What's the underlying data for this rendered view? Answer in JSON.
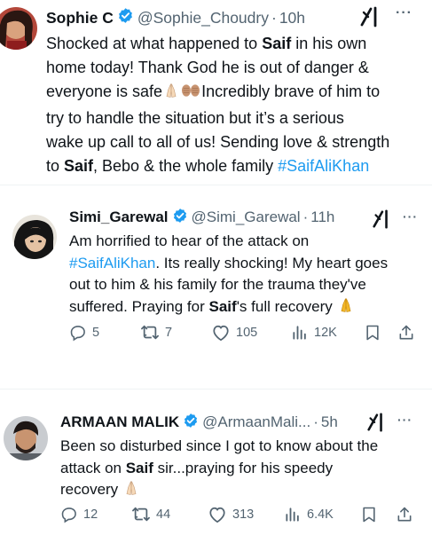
{
  "tweets": [
    {
      "name": "Sophie C",
      "handle": "@Sophie_Choudry",
      "time": "10h",
      "lines": [
        [
          {
            "t": "Shocked at what happened to "
          },
          {
            "t": "Saif",
            "s": "b"
          },
          {
            "t": " in his own"
          }
        ],
        [
          {
            "t": "home today! Thank God he is out of danger &"
          }
        ],
        [
          {
            "t": "everyone is safe"
          },
          {
            "e": "pray"
          },
          {
            "e": "hug"
          },
          {
            "t": "Incredibly brave of him to"
          }
        ],
        [
          {
            "t": "try to handle the situation but it’s a serious"
          }
        ],
        [
          {
            "t": "wake up call to all of us! Sending love & strength"
          }
        ],
        [
          {
            "t": "to "
          },
          {
            "t": "Saif",
            "s": "b"
          },
          {
            "t": ", Bebo & the whole family  "
          },
          {
            "t": "#SaifAliKhan",
            "s": "tag"
          }
        ]
      ]
    },
    {
      "name": "Simi_Garewal",
      "handle": "@Simi_Garewal",
      "time": "11h",
      "lines": [
        [
          {
            "t": "Am horrified to hear of the attack on"
          }
        ],
        [
          {
            "t": "#SaifAliKhan",
            "s": "tag"
          },
          {
            "t": ". Its really shocking! My heart goes"
          }
        ],
        [
          {
            "t": "out to him & his family for the trauma they've"
          }
        ],
        [
          {
            "t": "suffered. Praying for "
          },
          {
            "t": "Saif",
            "s": "b"
          },
          {
            "t": "'s full recovery "
          },
          {
            "e": "pray-gold"
          }
        ]
      ],
      "stats": {
        "replies": "5",
        "reposts": "7",
        "likes": "105",
        "views": "12K"
      }
    },
    {
      "name": "ARMAAN MALIK",
      "handle": "@ArmaanMali...",
      "time": "5h",
      "lines": [
        [
          {
            "t": "Been so disturbed since I got to know  about the"
          }
        ],
        [
          {
            "t": "attack on "
          },
          {
            "t": "Saif",
            "s": "b"
          },
          {
            "t": " sir...praying for his speedy"
          }
        ],
        [
          {
            "t": "recovery "
          },
          {
            "e": "pray"
          }
        ]
      ],
      "stats": {
        "replies": "12",
        "reposts": "44",
        "likes": "313",
        "views": "6.4K"
      }
    }
  ],
  "icons": [
    "verified-badge-icon",
    "grok-icon",
    "more-icon",
    "reply-icon",
    "repost-icon",
    "like-icon",
    "views-icon",
    "bookmark-icon",
    "share-icon"
  ],
  "colors": {
    "text": "#0f1419",
    "muted": "#536471",
    "link": "#1d9bf0",
    "verified": "#1d9bf0"
  }
}
